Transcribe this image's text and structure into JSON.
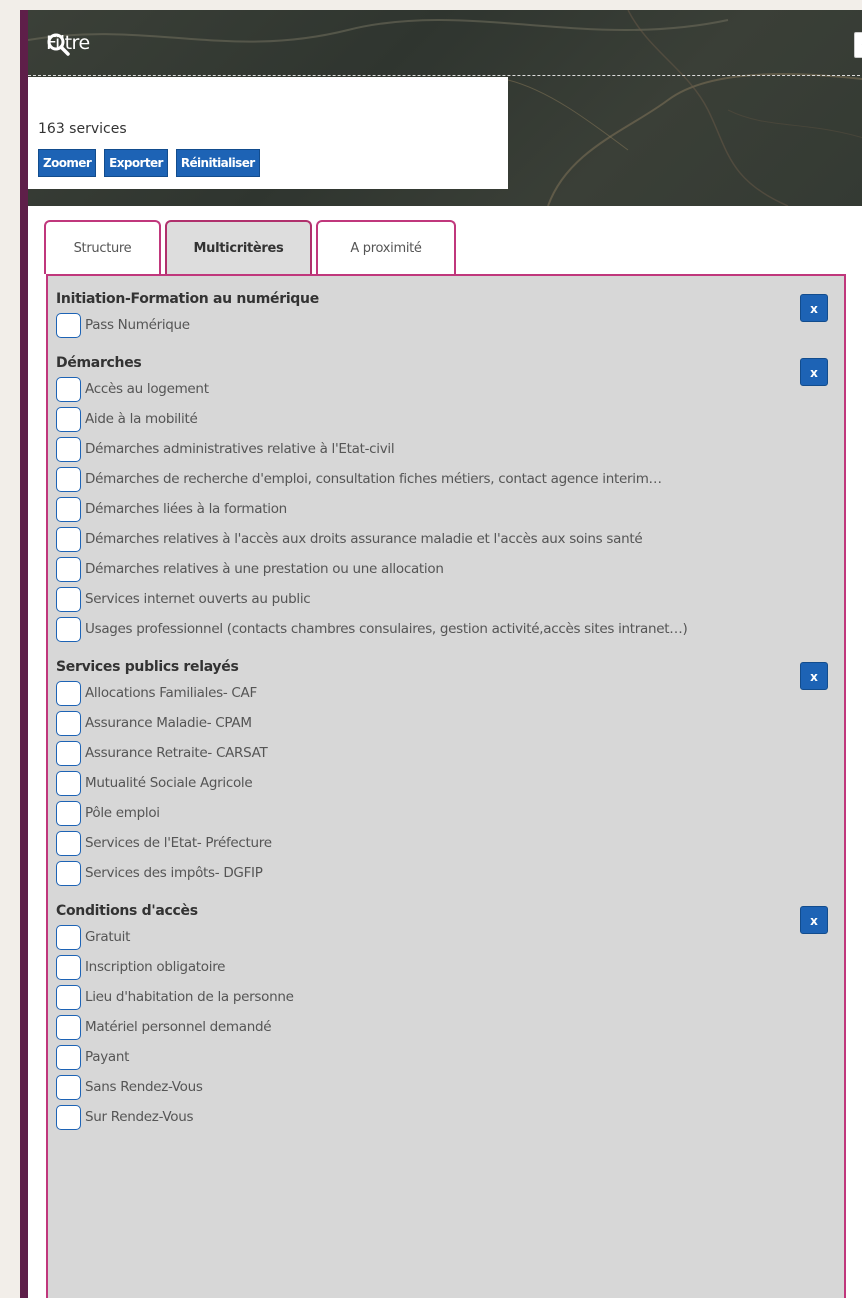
{
  "header": {
    "title": "Filtre"
  },
  "summary": {
    "count_text": "163 services"
  },
  "buttons": {
    "zoom": "Zoomer",
    "export": "Exporter",
    "reset": "Réinitialiser"
  },
  "tabs": [
    {
      "label": "Structure",
      "active": false
    },
    {
      "label": "Multicritères",
      "active": true
    },
    {
      "label": "A proximité",
      "active": false
    }
  ],
  "clear_label": "x",
  "sections": [
    {
      "title": "Initiation-Formation au numérique",
      "options": [
        "Pass Numérique"
      ]
    },
    {
      "title": "Démarches",
      "options": [
        "Accès au logement",
        "Aide à la mobilité",
        "Démarches administratives relative à l'Etat-civil",
        "Démarches de recherche d'emploi, consultation fiches métiers, contact agence interim…",
        "Démarches liées à la formation",
        "Démarches relatives à l'accès aux droits assurance maladie et l'accès aux soins santé",
        "Démarches relatives à une prestation ou une allocation",
        "Services internet ouverts au public",
        "Usages professionnel (contacts chambres consulaires, gestion activité,accès sites intranet…)"
      ]
    },
    {
      "title": "Services publics relayés",
      "options": [
        "Allocations Familiales- CAF",
        "Assurance Maladie- CPAM",
        "Assurance Retraite- CARSAT",
        "Mutualité Sociale Agricole",
        "Pôle emploi",
        "Services de l'Etat- Préfecture",
        "Services des impôts- DGFIP"
      ]
    },
    {
      "title": "Conditions d'accès",
      "options": [
        "Gratuit",
        "Inscription obligatoire",
        "Lieu d'habitation de la personne",
        "Matériel personnel demandé",
        "Payant",
        "Sans Rendez-Vous",
        "Sur Rendez-Vous"
      ]
    }
  ],
  "colors": {
    "accent": "#1d63b5",
    "tab_border": "#c0377c",
    "sidebar": "#5e1f49"
  }
}
